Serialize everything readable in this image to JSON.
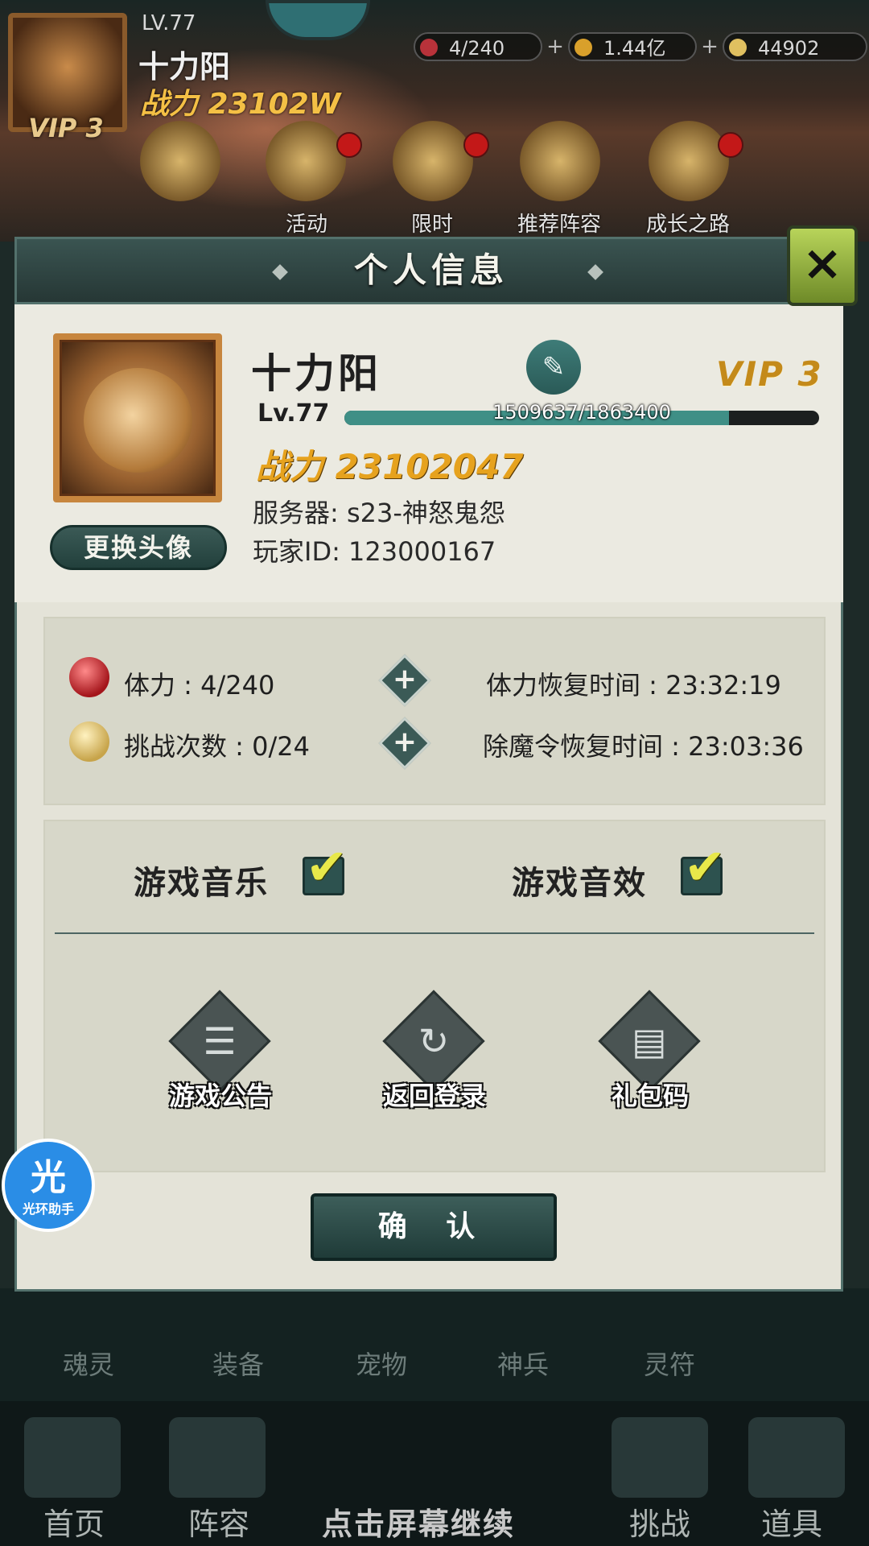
{
  "hud": {
    "level": "LV.77",
    "name": "十力阳",
    "power": "战力 23102W",
    "vip": "VIP 3",
    "resources": [
      {
        "value": "4/240",
        "color": "#b8323a"
      },
      {
        "value": "1.44亿",
        "color": "#d9a02b"
      },
      {
        "value": "44902",
        "color": "#e0c060"
      }
    ],
    "menu": [
      "活动",
      "限时",
      "推荐阵容",
      "成长之路"
    ]
  },
  "modal": {
    "title": "个人信息",
    "close_icon": "×"
  },
  "profile": {
    "name": "十力阳",
    "vip": "VIP 3",
    "level": "Lv.77",
    "exp_text": "1509637/1863400",
    "exp_fraction": 0.81,
    "power": "战力 23102047",
    "server": "服务器: s23-神怒鬼怨",
    "player_id": "玩家ID:  123000167",
    "change_avatar": "更换头像"
  },
  "stats": {
    "stamina": "体力 : 4/240",
    "stamina_recover": "体力恢复时间 : 23:32:19",
    "challenges": "挑战次数 : 0/24",
    "token_recover": "除魔令恢复时间 : 23:03:36"
  },
  "settings": {
    "music": "游戏音乐",
    "sound": "游戏音效",
    "music_on": true,
    "sound_on": true
  },
  "actions": {
    "announcement": "游戏公告",
    "back_login": "返回登录",
    "gift_code": "礼包码"
  },
  "confirm": "确 认",
  "helper": {
    "glyph": "光",
    "label": "光环助手"
  },
  "bottom_row": [
    "魂灵",
    "装备",
    "宠物",
    "神兵",
    "灵符"
  ],
  "nav": [
    "首页",
    "阵容",
    "挑战",
    "道具"
  ],
  "continue_text": "点击屏幕继续"
}
